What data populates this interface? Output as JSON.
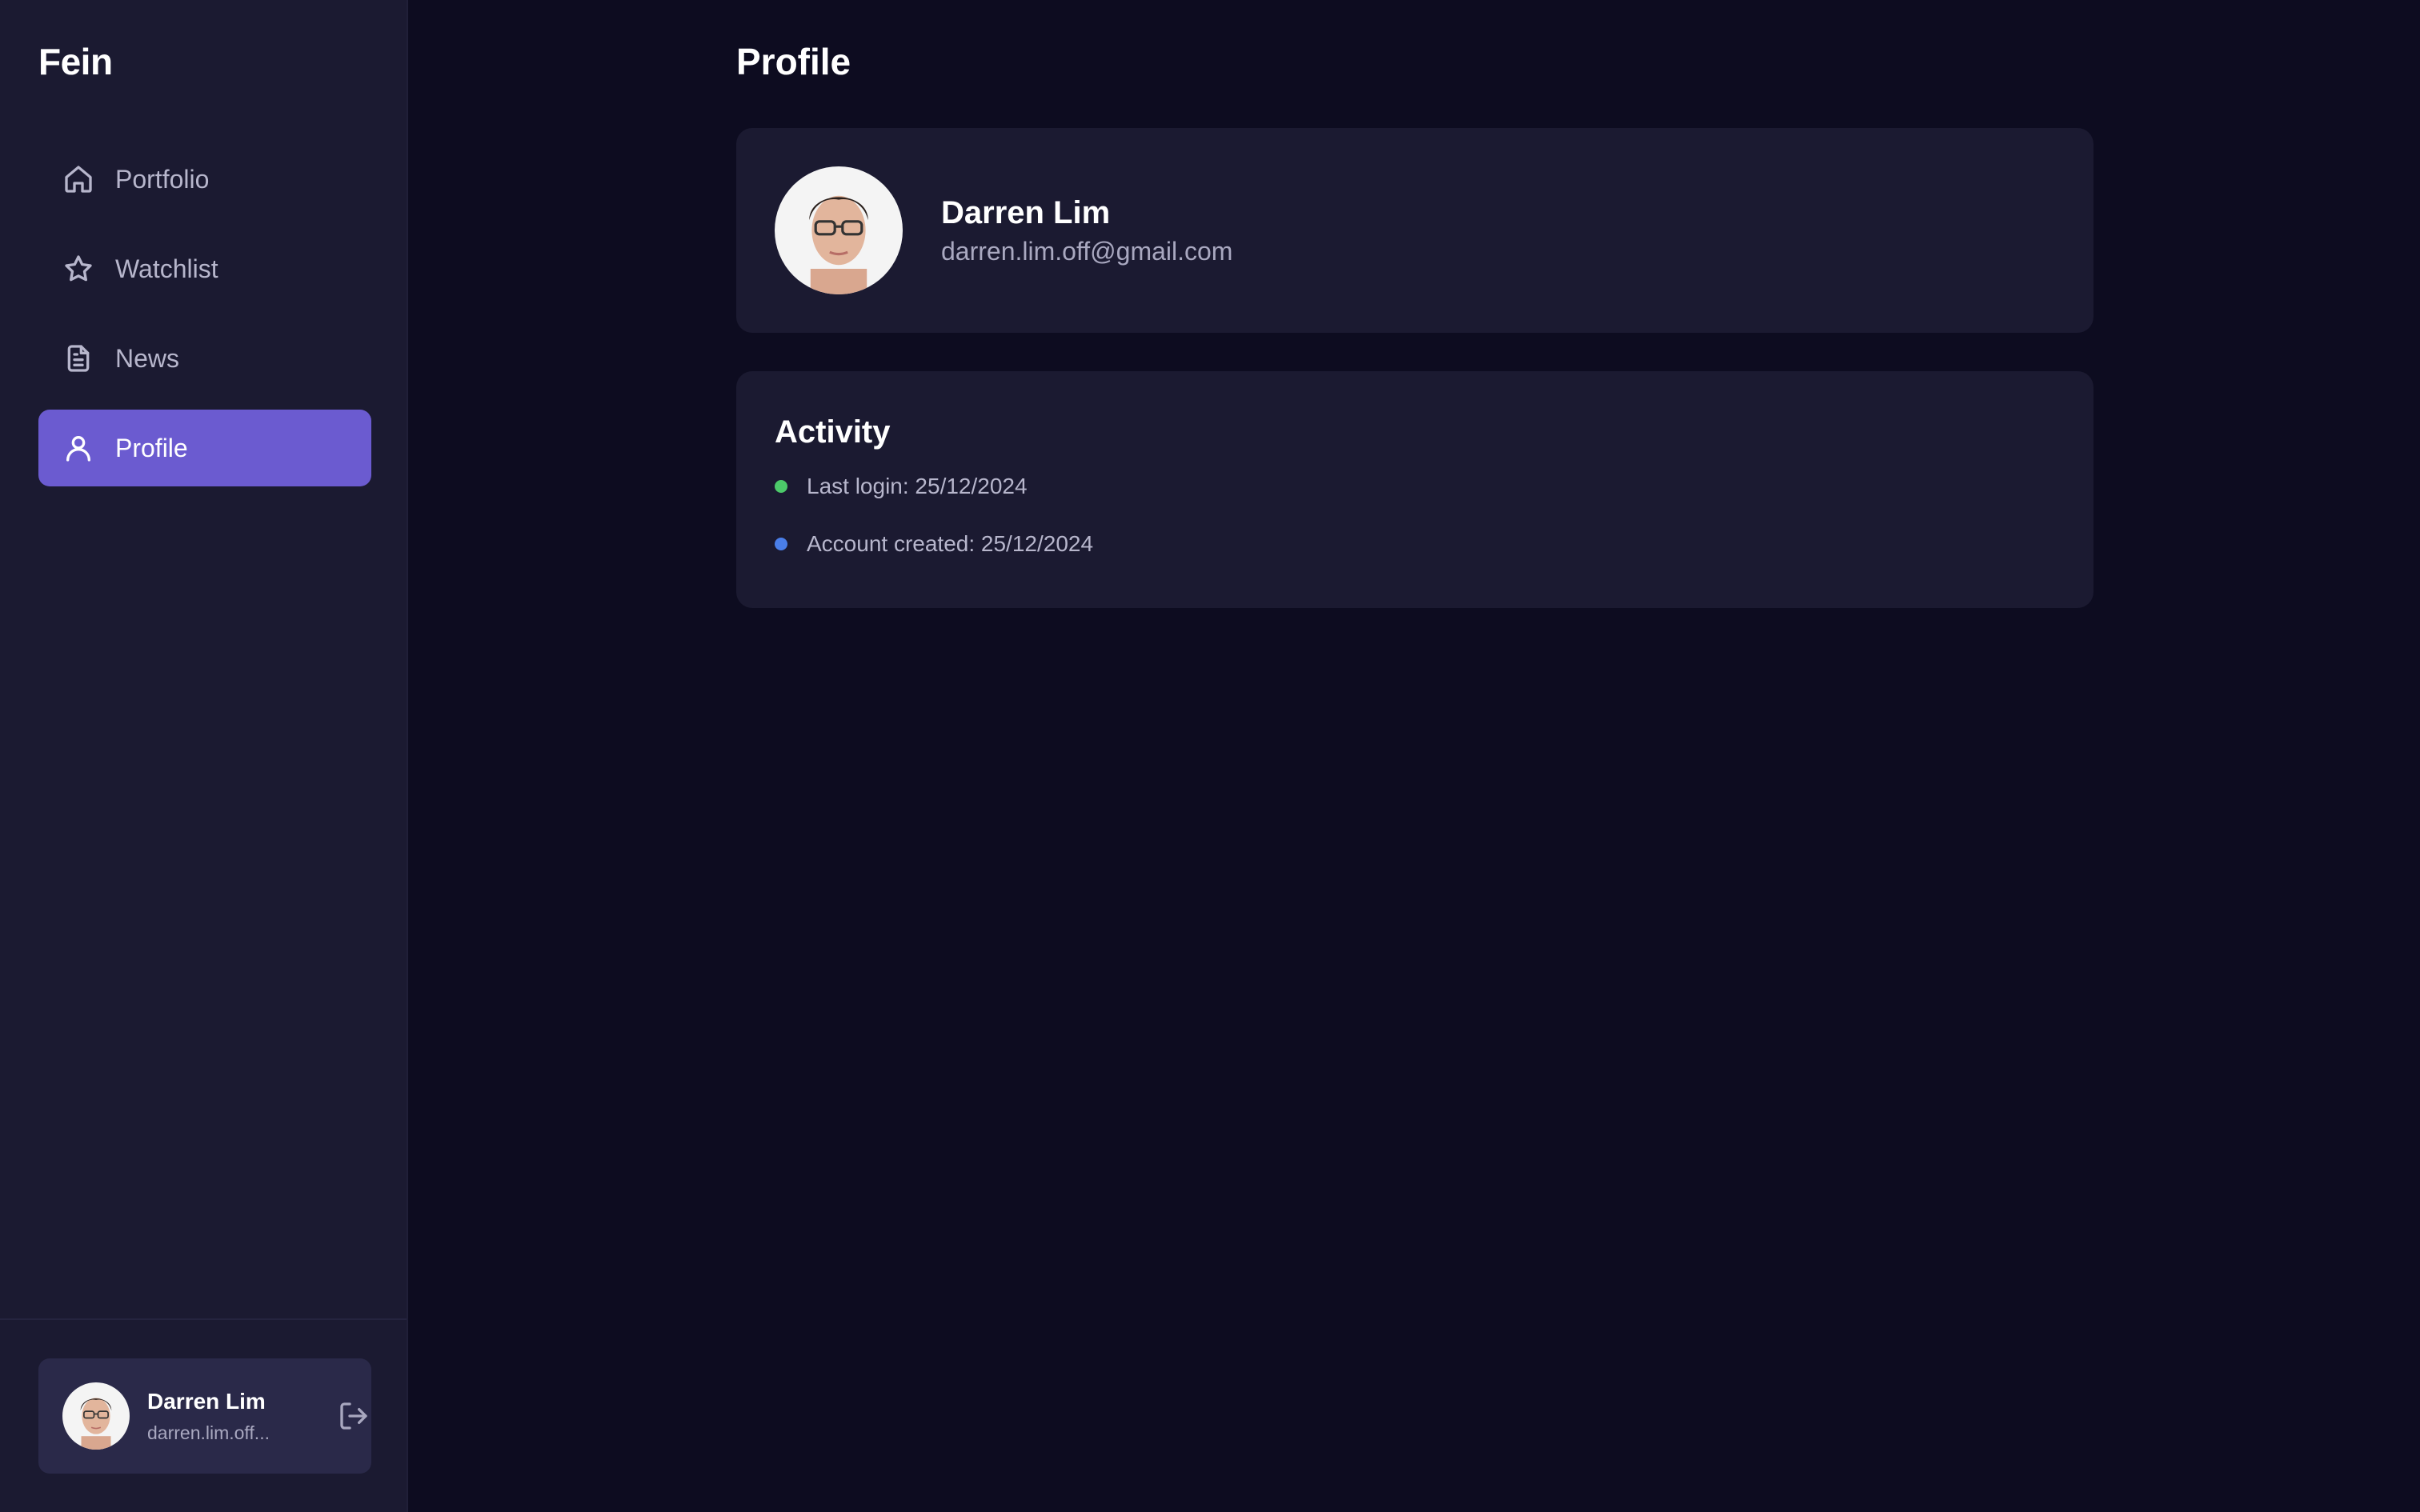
{
  "brand": "Fein",
  "sidebar": {
    "items": [
      {
        "label": "Portfolio",
        "icon": "home-icon",
        "active": false
      },
      {
        "label": "Watchlist",
        "icon": "star-icon",
        "active": false
      },
      {
        "label": "News",
        "icon": "document-icon",
        "active": false
      },
      {
        "label": "Profile",
        "icon": "user-icon",
        "active": true
      }
    ],
    "user": {
      "name": "Darren Lim",
      "email": "darren.lim.off...",
      "logout_icon": "logout-icon"
    }
  },
  "main": {
    "title": "Profile",
    "profile": {
      "name": "Darren Lim",
      "email": "darren.lim.off@gmail.com"
    },
    "activity": {
      "title": "Activity",
      "items": [
        {
          "text": "Last login: 25/12/2024",
          "color": "#4cc96a"
        },
        {
          "text": "Account created: 25/12/2024",
          "color": "#4a7ee8"
        }
      ]
    }
  },
  "colors": {
    "accent": "#6b5bd0",
    "background": "#0d0c20",
    "panel": "#1b1a31"
  }
}
